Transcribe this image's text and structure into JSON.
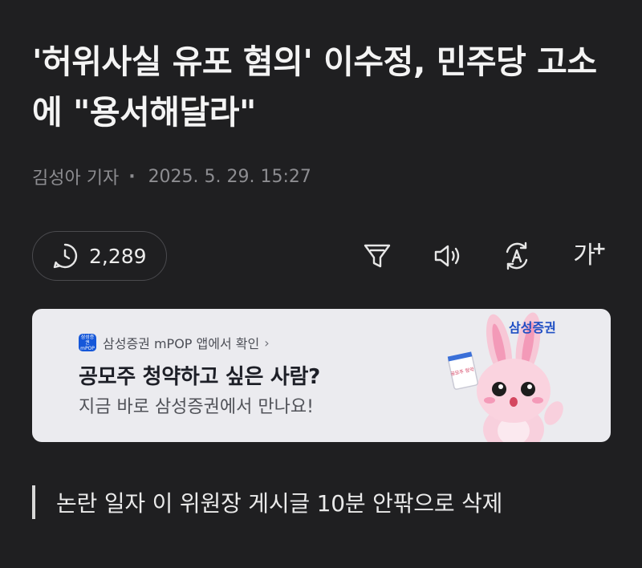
{
  "article": {
    "headline": "'허위사실 유포 혐의' 이수정, 민주당 고소에 \"용서해달라\"",
    "author": "김성아 기자",
    "datetime": "2025. 5. 29. 15:27"
  },
  "toolbar": {
    "view_count": "2,289",
    "font_size_label": "가",
    "font_size_plus": "+"
  },
  "ad": {
    "source_text": "삼성증권 mPOP 앱에서 확인",
    "source_chevron": "›",
    "app_icon_lines": [
      "삼성증권",
      "mPOP"
    ],
    "title": "공모주 청약하고 싶은 사람?",
    "subtitle": "지금 바로 삼성증권에서 만나요!",
    "brand": "삼성증권",
    "mascot_sign": "공모주 청약",
    "bg_color": "#ebebef",
    "brand_color": "#1f4fc4"
  },
  "subheading": {
    "text": "논란 일자 이 위원장 게시글 10분 안팎으로 삭제"
  },
  "colors": {
    "background": "#1f1f21",
    "text": "#f4f4f4",
    "muted": "#8d8d91"
  },
  "icons": {
    "views": "clock-icon",
    "summary": "funnel-icon",
    "tts": "speaker-icon",
    "translate": "translate-icon"
  }
}
